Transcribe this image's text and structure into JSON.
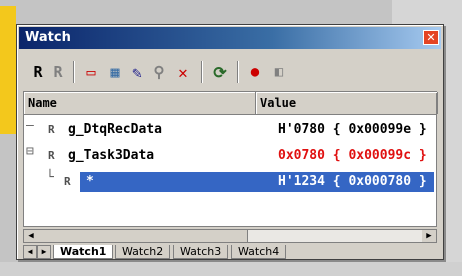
{
  "window": {
    "title": "Watch"
  },
  "toolbar": {
    "buttons": [
      {
        "name": "r-button",
        "glyph": "R",
        "color": "#000000"
      },
      {
        "name": "r-disabled-button",
        "glyph": "R",
        "color": "#808080"
      },
      {
        "name": "watch-window-icon",
        "glyph": "▭",
        "color": "#cc0000"
      },
      {
        "name": "grid-icon",
        "glyph": "▦",
        "color": "#3a6ea5"
      },
      {
        "name": "pencil-icon",
        "glyph": "✎",
        "color": "#1a1a8a"
      },
      {
        "name": "binoculars-icon",
        "glyph": "⚲",
        "color": "#808080"
      },
      {
        "name": "delete-icon",
        "glyph": "✕",
        "color": "#cc0000"
      },
      {
        "name": "refresh-icon",
        "glyph": "⟳",
        "color": "#2a6a2a"
      },
      {
        "name": "breakpoint-icon",
        "glyph": "●",
        "color": "#cc0000"
      },
      {
        "name": "breakpoint-disabled-icon",
        "glyph": "◧",
        "color": "#808080"
      }
    ]
  },
  "grid": {
    "columns": [
      "Name",
      "Value"
    ],
    "rows": [
      {
        "tree": "—",
        "name": "g_DtqRecData",
        "value": "H'0780 { 0x00099e }",
        "color": "#000000"
      },
      {
        "tree": "⊟",
        "name": "g_Task3Data",
        "value": "0x0780 { 0x00099c }",
        "color": "#e01010"
      },
      {
        "tree": "└",
        "name": "*",
        "value": "H'1234 { 0x000780 }",
        "color": "#ffffff"
      }
    ]
  },
  "tabs": [
    "Watch1",
    "Watch2",
    "Watch3",
    "Watch4"
  ]
}
